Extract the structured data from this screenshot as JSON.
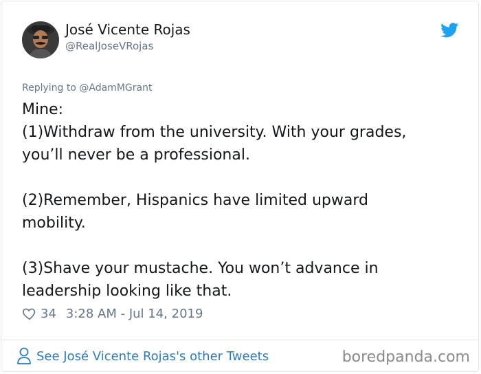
{
  "tweet": {
    "author_name": "José Vicente Rojas",
    "author_handle": "@RealJoseVRojas",
    "reply_context": "Replying to @AdamMGrant",
    "text_lines": [
      "Mine:",
      "(1)Withdraw from the university. With your grades,",
      "you’ll never be a professional.",
      "",
      "(2)Remember, Hispanics have limited upward",
      "mobility.",
      "",
      "(3)Shave your mustache. You won’t advance in",
      "leadership looking like that."
    ],
    "likes": "34",
    "timestamp": "3:28 AM - Jul 14, 2019"
  },
  "footer": {
    "other_tweets_link": "See José Vicente Rojas's other Tweets",
    "watermark": "boredpanda.com"
  },
  "icons": {
    "platform": "twitter-bird-icon",
    "like": "heart-icon",
    "profile": "person-icon"
  },
  "colors": {
    "brand": "#1da1f2",
    "secondary_text": "#657786",
    "link": "#2b7bb9",
    "border": "#e1e8ed"
  }
}
